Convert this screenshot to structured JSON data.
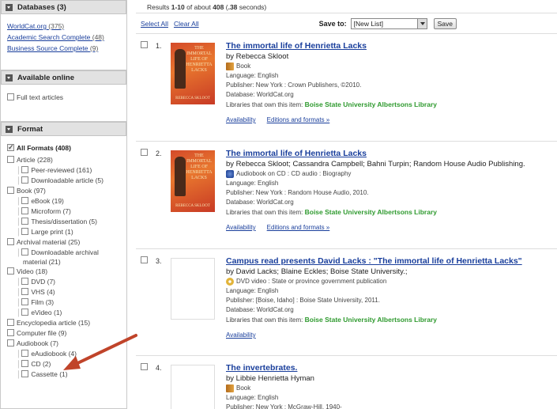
{
  "sidebar": {
    "databases": {
      "title": "Databases (3)",
      "items": [
        {
          "label": "WorldCat.org",
          "count": "(375)"
        },
        {
          "label": "Academic Search Complete",
          "count": "(48)"
        },
        {
          "label": "Business Source Complete",
          "count": "(9)"
        }
      ]
    },
    "online": {
      "title": "Available online",
      "items": [
        {
          "label": "Full text articles"
        }
      ]
    },
    "format": {
      "title": "Format",
      "items": [
        {
          "label": "All Formats (408)",
          "level": 0,
          "checked": true
        },
        {
          "label": "Article (228)",
          "level": 0
        },
        {
          "label": "Peer-reviewed (161)",
          "level": 1
        },
        {
          "label": "Downloadable article (5)",
          "level": 1
        },
        {
          "label": "Book (97)",
          "level": 0
        },
        {
          "label": "eBook (19)",
          "level": 1
        },
        {
          "label": "Microform (7)",
          "level": 1
        },
        {
          "label": "Thesis/dissertation (5)",
          "level": 1
        },
        {
          "label": "Large print (1)",
          "level": 1
        },
        {
          "label": "Archival material (25)",
          "level": 0
        },
        {
          "label": "Downloadable archival material (21)",
          "level": 2
        },
        {
          "label": "Video (18)",
          "level": 0
        },
        {
          "label": "DVD (7)",
          "level": 1
        },
        {
          "label": "VHS (4)",
          "level": 1
        },
        {
          "label": "Film (3)",
          "level": 1
        },
        {
          "label": "eVideo (1)",
          "level": 1
        },
        {
          "label": "Encyclopedia article (15)",
          "level": 0
        },
        {
          "label": "Computer file (9)",
          "level": 0
        },
        {
          "label": "Audiobook (7)",
          "level": 0
        },
        {
          "label": "eAudiobook (4)",
          "level": 1
        },
        {
          "label": "CD (2)",
          "level": 1
        },
        {
          "label": "Cassette (1)",
          "level": 1
        }
      ]
    }
  },
  "results": {
    "prefix": "Results ",
    "range": "1-10",
    "mid": " of about ",
    "total": "408",
    "time_pre": " (",
    "time": ".38",
    "time_post": " seconds)"
  },
  "toolbar": {
    "select_all": "Select All",
    "clear_all": "Clear All",
    "save_to_label": "Save to:",
    "save_to_value": "[New List]",
    "save_button": "Save"
  },
  "records": [
    {
      "num": "1.",
      "title": "The immortal life of Henrietta Lacks",
      "by": "by Rebecca Skloot",
      "format": "Book",
      "format_icon": "book-icon",
      "cover": "red",
      "cover_title": "THE IMMORTAL LIFE OF HENRIETTA LACKS",
      "cover_author": "REBECCA SKLOOT",
      "language": "Language: English",
      "publisher": "Publisher: New York : Crown Publishers, ©2010.",
      "database": "Database: WorldCat.org",
      "libraries_label": "Libraries that own this item: ",
      "library": "Boise State University Albertsons Library",
      "links": [
        "Availability",
        "Editions and formats »"
      ]
    },
    {
      "num": "2.",
      "title": "The immortal life of Henrietta Lacks",
      "by": "by Rebecca Skloot; Cassandra Campbell; Bahni Turpin; Random House Audio Publishing.",
      "format": "Audiobook on CD : CD audio : Biography",
      "format_icon": "audio-icon",
      "cover": "red",
      "cover_title": "THE IMMORTAL LIFE OF HENRIETTA LACKS",
      "cover_author": "REBECCA SKLOOT",
      "language": "Language: English",
      "publisher": "Publisher: New York : Random House Audio, 2010.",
      "database": "Database: WorldCat.org",
      "libraries_label": "Libraries that own this item: ",
      "library": "Boise State University Albertsons Library",
      "links": [
        "Availability",
        "Editions and formats »"
      ]
    },
    {
      "num": "3.",
      "title": "Campus read presents David Lacks : \"The immortal life of Henrietta Lacks\"",
      "by": "by David Lacks; Blaine Eckles; Boise State University.;",
      "format": "DVD video : State or province government publication",
      "format_icon": "dvd-icon",
      "cover": "blank",
      "language": "Language: English",
      "publisher": "Publisher: [Boise, Idaho] : Boise State University, 2011.",
      "database": "Database: WorldCat.org",
      "libraries_label": "Libraries that own this item: ",
      "library": "Boise State University Albertsons Library",
      "links": [
        "Availability"
      ]
    },
    {
      "num": "4.",
      "title": "The invertebrates.",
      "by": "by Libbie Henrietta Hyman",
      "format": "Book",
      "format_icon": "book-icon",
      "cover": "blank",
      "language": "Language: English",
      "publisher": "Publisher: New York : McGraw-Hill, 1940-",
      "database": "",
      "libraries_label": "",
      "library": "",
      "links": []
    }
  ],
  "colors": {
    "link": "#1a3f9c",
    "library": "#2f9a2f",
    "annotation_arrow": "#c0442a"
  }
}
